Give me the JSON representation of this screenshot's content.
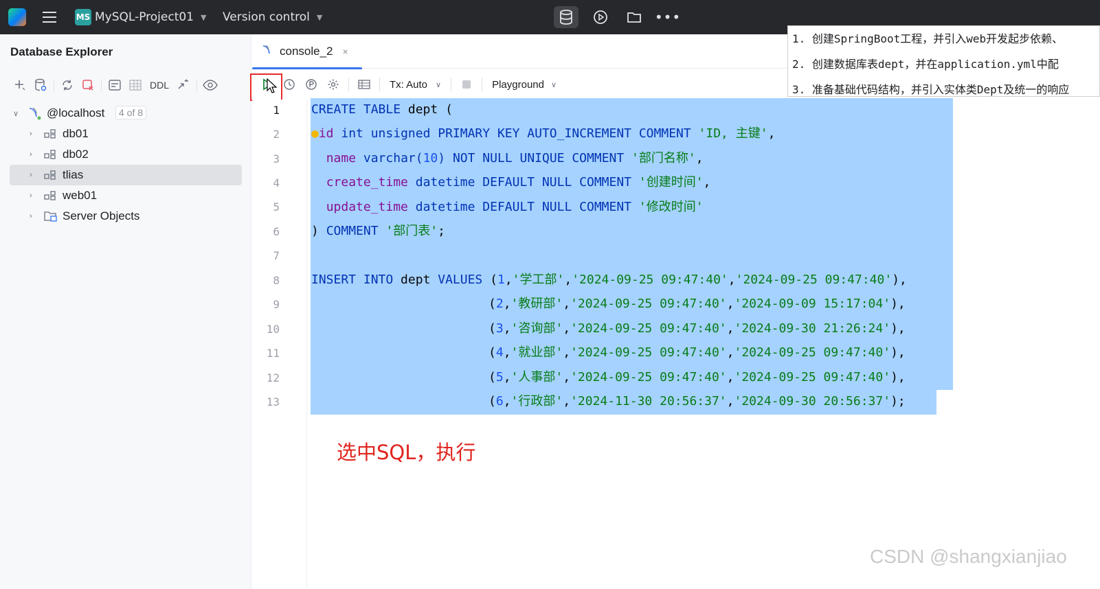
{
  "titlebar": {
    "project_badge": "MS",
    "project_name": "MySQL-Project01",
    "vcs_label": "Version control"
  },
  "explorer": {
    "title": "Database Explorer",
    "ddl_label": "DDL",
    "root": {
      "label": "@localhost",
      "count": "4 of 8"
    },
    "items": [
      {
        "label": "db01"
      },
      {
        "label": "db02"
      },
      {
        "label": "tlias"
      },
      {
        "label": "web01"
      },
      {
        "label": "Server Objects"
      }
    ]
  },
  "editor": {
    "tab_label": "console_2",
    "tab_close": "×",
    "tx_label": "Tx: Auto",
    "playground_label": "Playground",
    "line_numbers": [
      "1",
      "2",
      "3",
      "4",
      "5",
      "6",
      "7",
      "8",
      "9",
      "10",
      "11",
      "12",
      "13"
    ]
  },
  "code": {
    "l1": [
      "CREATE TABLE",
      " dept ("
    ],
    "l2": [
      "id",
      " int unsigned PRIMARY KEY AUTO_INCREMENT COMMENT ",
      "'ID, 主键'",
      ","
    ],
    "l3": [
      "name",
      " varchar(",
      "10",
      ") NOT NULL UNIQUE COMMENT ",
      "'部门名称'",
      ","
    ],
    "l4": [
      "create_time",
      " datetime DEFAULT NULL COMMENT ",
      "'创建时间'",
      ","
    ],
    "l5": [
      "update_time",
      " datetime DEFAULT NULL COMMENT ",
      "'修改时间'"
    ],
    "l6": [
      ") ",
      "COMMENT",
      " ",
      "'部门表'",
      ";"
    ],
    "l8": [
      "INSERT INTO",
      " dept ",
      "VALUES",
      " (",
      "1",
      ",",
      "'学工部'",
      ",",
      "'2024-09-25 09:47:40'",
      ",",
      "'2024-09-25 09:47:40'",
      "),"
    ],
    "l9": [
      "(",
      "2",
      ",",
      "'教研部'",
      ",",
      "'2024-09-25 09:47:40'",
      ",",
      "'2024-09-09 15:17:04'",
      "),"
    ],
    "l10": [
      "(",
      "3",
      ",",
      "'咨询部'",
      ",",
      "'2024-09-25 09:47:40'",
      ",",
      "'2024-09-30 21:26:24'",
      "),"
    ],
    "l11": [
      "(",
      "4",
      ",",
      "'就业部'",
      ",",
      "'2024-09-25 09:47:40'",
      ",",
      "'2024-09-25 09:47:40'",
      "),"
    ],
    "l12": [
      "(",
      "5",
      ",",
      "'人事部'",
      ",",
      "'2024-09-25 09:47:40'",
      ",",
      "'2024-09-25 09:47:40'",
      "),"
    ],
    "l13": [
      "(",
      "6",
      ",",
      "'行政部'",
      ",",
      "'2024-11-30 20:56:37'",
      ",",
      "'2024-09-30 20:56:37'",
      ");"
    ]
  },
  "annotation": "选中SQL，执行",
  "notes": [
    "1. 创建SpringBoot工程，并引入web开发起步依赖、",
    "2. 创建数据库表dept，并在application.yml中配",
    "3. 准备基础代码结构，并引入实体类Dept及统一的响应"
  ],
  "watermark": "CSDN @shangxianjiao",
  "colors": {
    "titlebar_bg": "#27282c",
    "selection": "#a6d2ff",
    "keyword": "#0033b3",
    "string": "#067d17",
    "number": "#1750eb",
    "column": "#871094",
    "annotation": "#e0241e",
    "run_highlight": "#e52b2b"
  }
}
